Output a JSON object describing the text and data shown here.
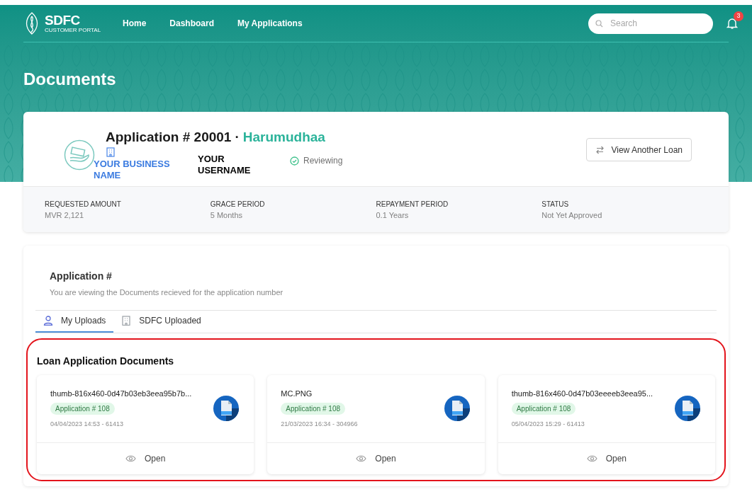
{
  "header": {
    "logo": {
      "name": "SDFC",
      "subtitle": "CUSTOMER PORTAL"
    },
    "nav": [
      {
        "label": "Home"
      },
      {
        "label": "Dashboard"
      },
      {
        "label": "My Applications"
      }
    ],
    "search": {
      "placeholder": "Search"
    },
    "notifications": {
      "count": "3"
    }
  },
  "page_title": "Documents",
  "application": {
    "title": "Application # 20001",
    "separator": "·",
    "name": "Harumudhaa",
    "business": "YOUR BUSINESS NAME",
    "username": "YOUR USERNAME",
    "status": "Reviewing",
    "button": "View Another Loan",
    "stats": [
      {
        "label": "REQUESTED AMOUNT",
        "value": "MVR 2,121"
      },
      {
        "label": "GRACE PERIOD",
        "value": "5 Months"
      },
      {
        "label": "REPAYMENT PERIOD",
        "value": "0.1 Years"
      },
      {
        "label": "STATUS",
        "value": "Not Yet Approved"
      }
    ]
  },
  "documents_section": {
    "title": "Application #",
    "description": "You are viewing the Documents recieved for the application number",
    "tabs": [
      {
        "label": "My Uploads",
        "kind": "person",
        "selected": true
      },
      {
        "label": "SDFC Uploaded",
        "kind": "building",
        "selected": false
      }
    ],
    "heading": "Loan Application Documents",
    "highlighted": true,
    "files": [
      {
        "name": "thumb-816x460-0d47b03eb3eea95b7b...",
        "tag": "Application # 108",
        "meta": "04/04/2023 14:53 - 61413",
        "action": "Open"
      },
      {
        "name": "MC.PNG",
        "tag": "Application # 108",
        "meta": "21/03/2023 16:34 - 304966",
        "action": "Open"
      },
      {
        "name": "thumb-816x460-0d47b03eeeeb3eea95...",
        "tag": "Application # 108",
        "meta": "05/04/2023 15:29 - 61413",
        "action": "Open"
      }
    ]
  }
}
